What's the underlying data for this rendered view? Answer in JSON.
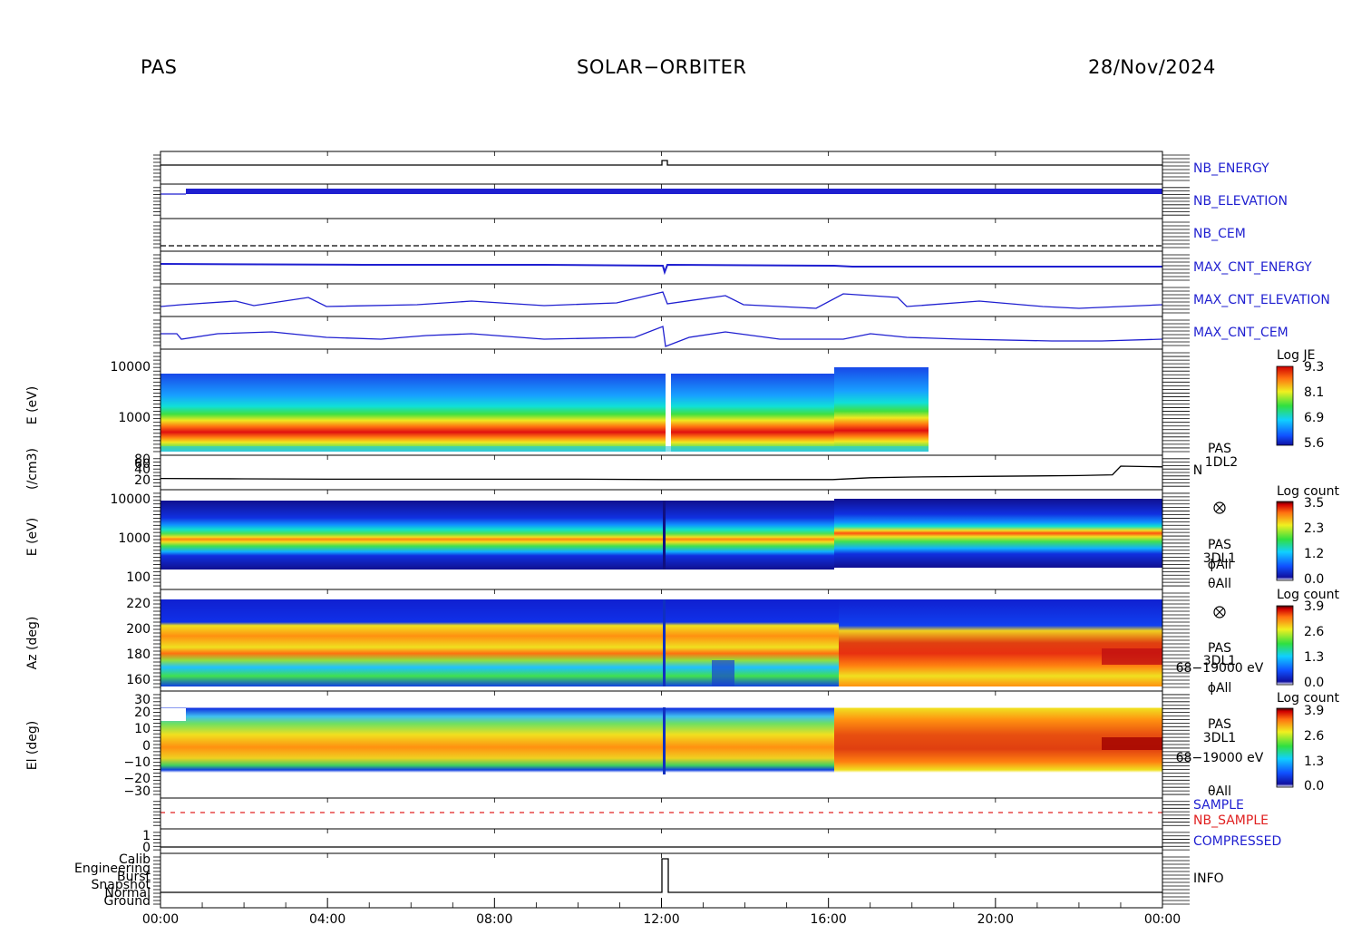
{
  "header": {
    "left": "PAS",
    "center": "SOLAR−ORBITER",
    "right": "28/Nov/2024"
  },
  "colors": {
    "housekeeping": "#1f1fd0",
    "nb_sample": "#e02020",
    "black": "#000000"
  },
  "time_axis": {
    "ticks": [
      "00:00",
      "04:00",
      "08:00",
      "12:00",
      "16:00",
      "20:00",
      "00:00"
    ],
    "range_hours": [
      0,
      24
    ]
  },
  "housekeeping_labels": {
    "nb_energy": "NB_ENERGY",
    "nb_elevation": "NB_ELEVATION",
    "nb_cem": "NB_CEM",
    "max_cnt_energy": "MAX_CNT_ENERGY",
    "max_cnt_elevation": "MAX_CNT_ELEVATION",
    "max_cnt_cem": "MAX_CNT_CEM",
    "sample": "SAMPLE",
    "nb_sample": "NB_SAMPLE",
    "compressed": "COMPRESSED",
    "info": "INFO"
  },
  "panels": {
    "e_je": {
      "ylabel": "E (eV)",
      "ticks": [
        "10000",
        "1000"
      ],
      "cbar_title": "Log JE",
      "cbar_ticks": [
        "9.3",
        "8.1",
        "6.9",
        "5.6"
      ]
    },
    "density": {
      "ylabel": "(/cm3)",
      "ticks": [
        "80",
        "60",
        "40",
        "20"
      ],
      "label_lines": [
        "PAS",
        "1DL2",
        "N"
      ]
    },
    "e_counts": {
      "ylabel": "E (eV)",
      "ticks": [
        "10000",
        "1000",
        "100"
      ],
      "cbar_title": "Log count",
      "cbar_ticks": [
        "3.5",
        "2.3",
        "1.2",
        "0.0"
      ],
      "label_lines": [
        "PAS",
        "3DL1",
        "ϕAll",
        "θAll"
      ]
    },
    "az": {
      "ylabel": "Az (deg)",
      "ticks": [
        "220",
        "200",
        "180",
        "160"
      ],
      "cbar_title": "Log count",
      "cbar_ticks": [
        "3.9",
        "2.6",
        "1.3",
        "0.0"
      ],
      "label_lines": [
        "PAS",
        "3DL1",
        "68−19000 eV",
        "ϕAll"
      ]
    },
    "el": {
      "ylabel": "El (deg)",
      "ticks": [
        "30",
        "20",
        "10",
        "0",
        "−10",
        "−20",
        "−30"
      ],
      "cbar_title": "Log count",
      "cbar_ticks": [
        "3.9",
        "2.6",
        "1.3",
        "0.0"
      ],
      "label_lines": [
        "PAS",
        "3DL1",
        "68−19000 eV",
        "θAll"
      ]
    },
    "info": {
      "ticks": [
        "Calib",
        "Engineering",
        "Burst",
        "Snapshot",
        "Normal",
        "Ground"
      ]
    },
    "compressed": {
      "ticks": [
        "1",
        "0"
      ]
    }
  },
  "chart_data": {
    "type": "heatmap",
    "x_unit": "UT hours",
    "x_range": [
      0,
      24
    ],
    "density_N": {
      "x": [
        0,
        2,
        4,
        6,
        8,
        10,
        12,
        14,
        16.1,
        17,
        18,
        20,
        22,
        22.8,
        23,
        24
      ],
      "y": [
        26,
        25,
        24,
        24,
        24,
        24,
        23,
        23,
        23,
        28,
        30,
        32,
        34,
        36,
        60,
        58
      ]
    },
    "energy_peak_eV": {
      "x": [
        0,
        4,
        8,
        12,
        13.8,
        16.2,
        18.4
      ],
      "y": [
        800,
        750,
        780,
        730,
        850,
        1000,
        1000
      ]
    },
    "je_data_end_hour": 18.4,
    "info_burst_step_hours": [
      12.0,
      12.15
    ]
  }
}
